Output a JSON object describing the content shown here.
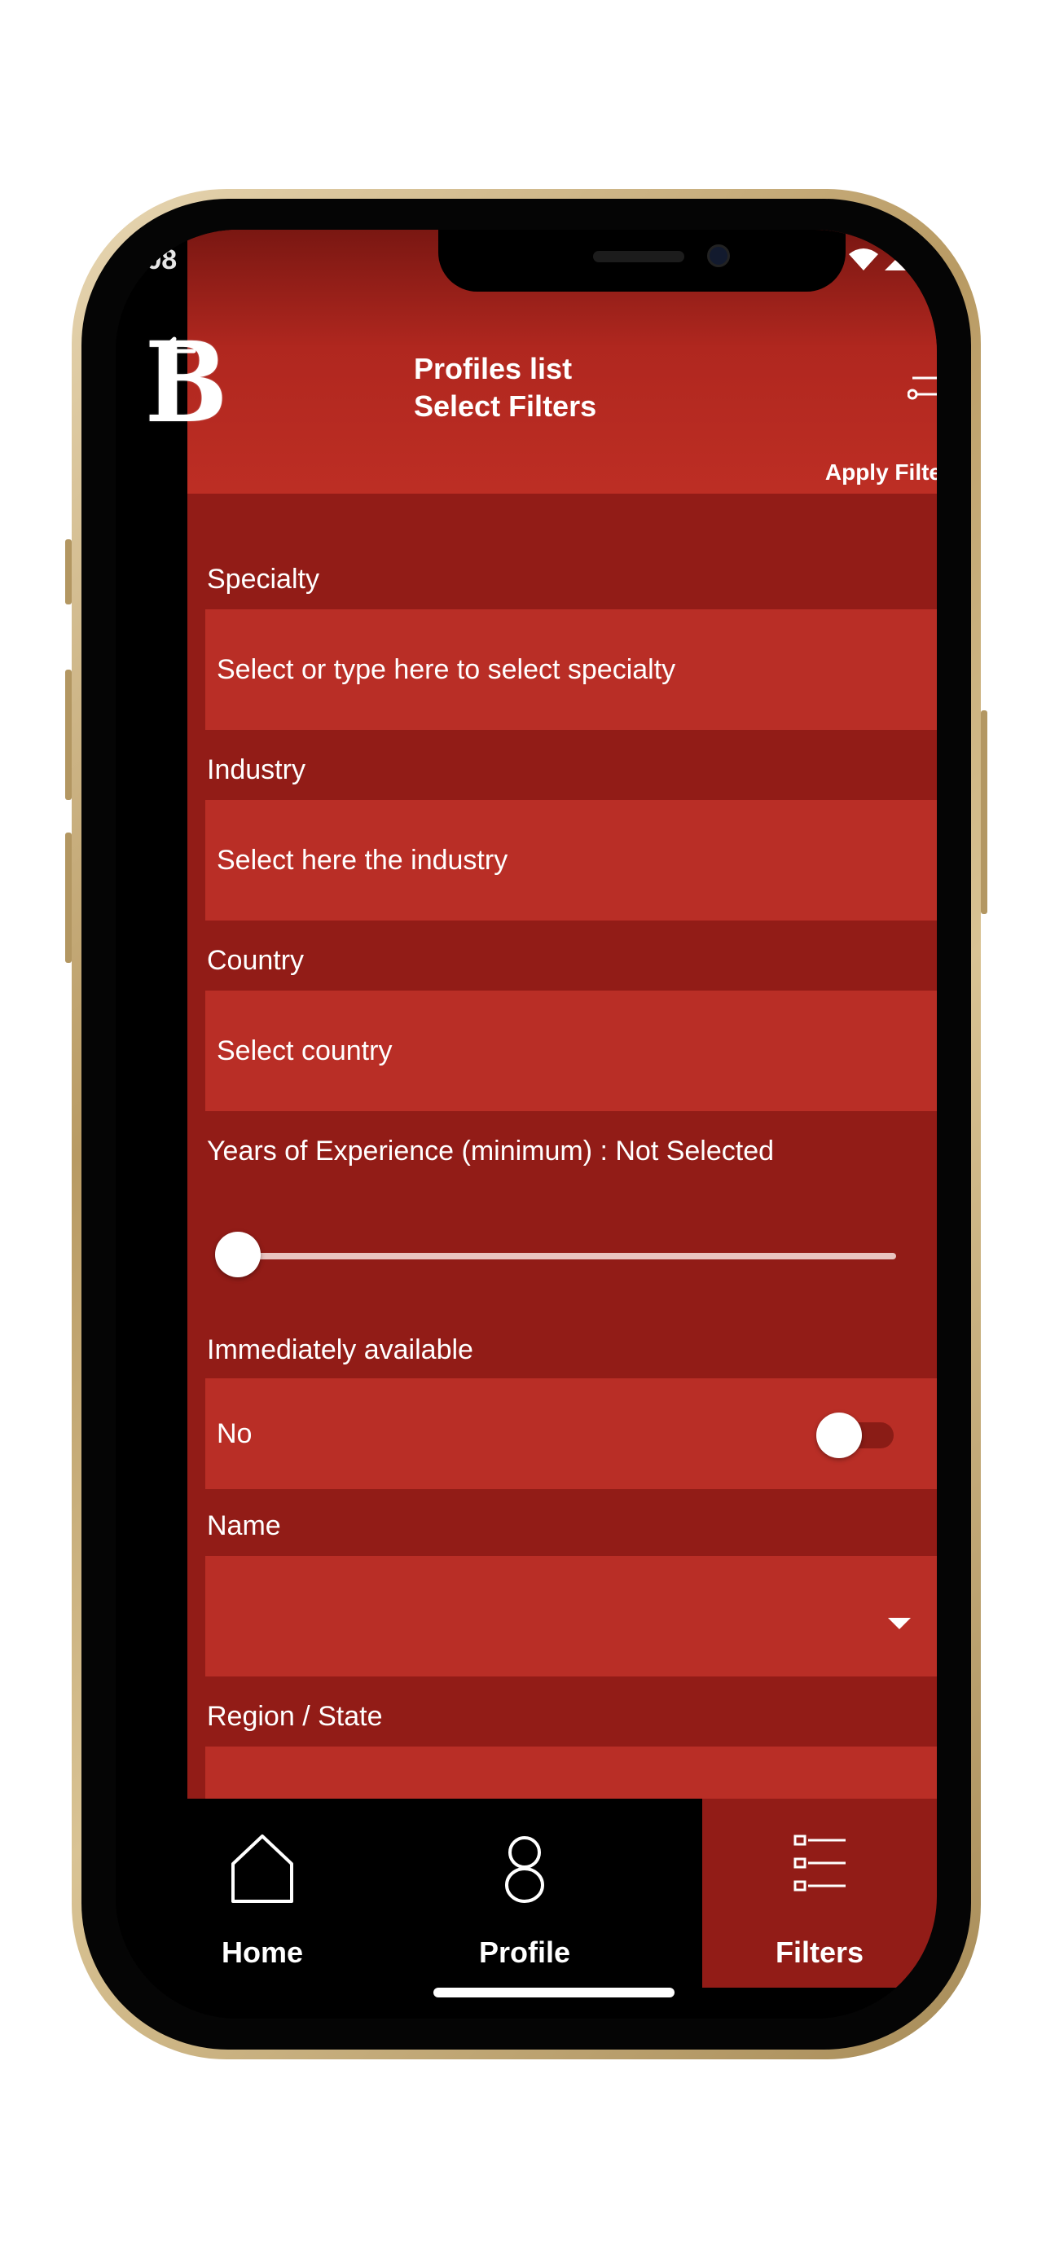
{
  "status_bar": {
    "time": ":08",
    "signal_icons": "wifi-signal-battery"
  },
  "header": {
    "logo_letter": "B",
    "title_line1": "Profiles list",
    "title_line2": "Select Filters",
    "apply_label": "Apply Filte"
  },
  "form": {
    "specialty": {
      "label": "Specialty",
      "placeholder": "Select or type here to select specialty"
    },
    "industry": {
      "label": "Industry",
      "placeholder": "Select here the industry"
    },
    "country": {
      "label": "Country",
      "placeholder": "Select country"
    },
    "experience": {
      "label": "Years of Experience (minimum) : Not Selected",
      "value_fraction": 0.0
    },
    "availability": {
      "label": "Immediately available",
      "value": "No",
      "toggle_on": false
    },
    "name": {
      "label": "Name",
      "value": ""
    },
    "region": {
      "label": "Region / State"
    }
  },
  "nav": {
    "home": "Home",
    "profile": "Profile",
    "filters": "Filters",
    "active": "filters"
  },
  "colors": {
    "accent": "#b92e26",
    "background": "#921c17",
    "nav_bg": "#000000"
  }
}
